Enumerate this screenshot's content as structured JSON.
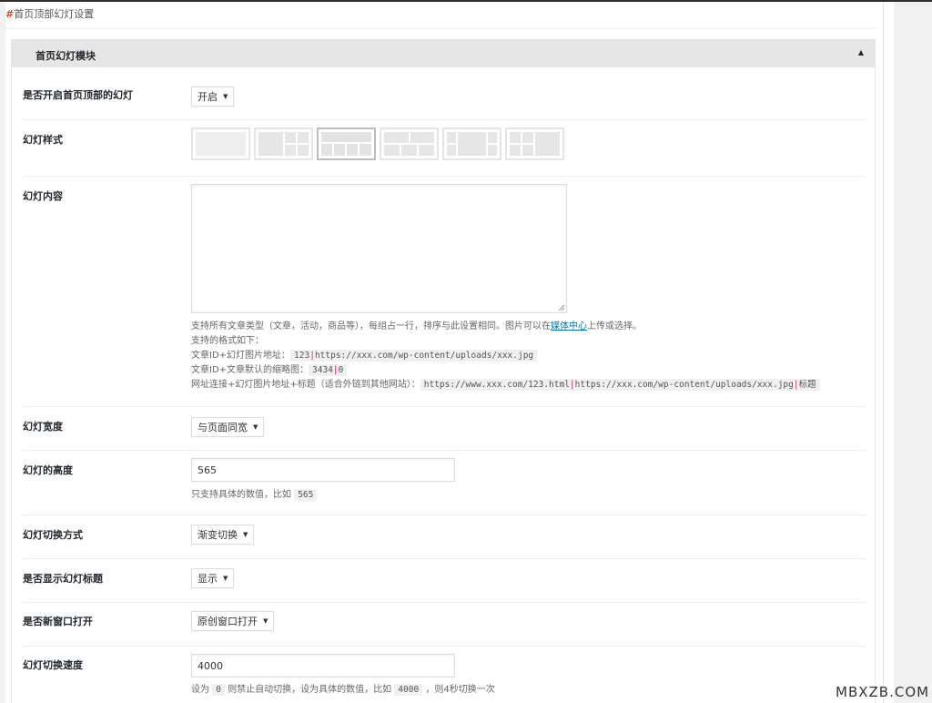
{
  "breadcrumb": {
    "hash": "#",
    "text": "首页顶部幻灯设置"
  },
  "panel": {
    "title": "首页幻灯模块",
    "collapse_icon": "▲"
  },
  "fields": {
    "enable": {
      "label": "是否开启首页顶部的幻灯",
      "value": "开启"
    },
    "style": {
      "label": "幻灯样式",
      "options": [
        "style-1",
        "style-2",
        "style-3",
        "style-4",
        "style-5",
        "style-6"
      ],
      "selected": 2
    },
    "content": {
      "label": "幻灯内容",
      "value": "",
      "help_1_pre": "支持所有文章类型（文章，活动，商品等），每组占一行，排序与此设置相同。图片可以在",
      "help_1_link": "媒体中心",
      "help_1_post": "上传或选择。",
      "help_2": "支持的格式如下：",
      "help_3_label": "文章ID+幻灯图片地址：",
      "help_3_code_a": "123",
      "help_3_code_b": "https://xxx.com/wp-content/uploads/xxx.jpg",
      "help_4_label": "文章ID+文章默认的缩略图：",
      "help_4_code_a": "3434",
      "help_4_code_b": "0",
      "help_5_label": "网址连接+幻灯图片地址+标题（适合外链到其他网站）：",
      "help_5_code_a": "https://www.xxx.com/123.html",
      "help_5_code_b": "https://xxx.com/wp-content/uploads/xxx.jpg",
      "help_5_code_c": "标题",
      "pipe": "|"
    },
    "width": {
      "label": "幻灯宽度",
      "value": "与页面同宽"
    },
    "height": {
      "label": "幻灯的高度",
      "value": "565",
      "help_pre": "只支持具体的数值，比如",
      "help_code": "565"
    },
    "transition": {
      "label": "幻灯切换方式",
      "value": "渐变切换"
    },
    "show_title": {
      "label": "是否显示幻灯标题",
      "value": "显示"
    },
    "new_window": {
      "label": "是否新窗口打开",
      "value": "原创窗口打开"
    },
    "speed": {
      "label": "幻灯切换速度",
      "value": "4000",
      "help_a": "设为",
      "help_code_1": "0",
      "help_b": "则禁止自动切换，设为具体的数值，比如",
      "help_code_2": "4000",
      "help_c": "，则4秒切换一次"
    }
  },
  "caret": "▼",
  "watermark": "MBXZB.COM"
}
